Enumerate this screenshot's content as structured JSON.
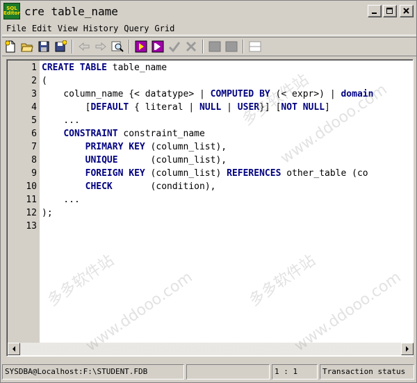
{
  "window": {
    "title": "cre table_name",
    "icon_lines": [
      "SQL",
      "Editor"
    ]
  },
  "menu": [
    "File",
    "Edit",
    "View",
    "History",
    "Query",
    "Grid"
  ],
  "toolbar": {
    "buttons": [
      "new-icon",
      "open-icon",
      "save-icon",
      "save-as-icon",
      "back-icon",
      "forward-icon",
      "find-icon",
      "execute-icon",
      "execute-step-icon",
      "commit-icon",
      "rollback-icon",
      "grid-icon",
      "grid2-icon",
      "split-icon"
    ]
  },
  "editor": {
    "line_numbers": [
      "1",
      "2",
      "3",
      "4",
      "5",
      "6",
      "7",
      "8",
      "9",
      "10",
      "11",
      "12",
      "13"
    ],
    "lines": [
      [
        {
          "t": "CREATE TABLE",
          "k": 1
        },
        {
          "t": " table_name",
          "k": 0
        }
      ],
      [
        {
          "t": "(",
          "k": 0
        }
      ],
      [
        {
          "t": "    column_name {< datatype> | ",
          "k": 0
        },
        {
          "t": "COMPUTED BY",
          "k": 1
        },
        {
          "t": " (< expr>) | ",
          "k": 0
        },
        {
          "t": "domain",
          "k": 1
        }
      ],
      [
        {
          "t": "        [",
          "k": 0
        },
        {
          "t": "DEFAULT",
          "k": 1
        },
        {
          "t": " { literal | ",
          "k": 0
        },
        {
          "t": "NULL",
          "k": 1
        },
        {
          "t": " | ",
          "k": 0
        },
        {
          "t": "USER",
          "k": 1
        },
        {
          "t": "}] [",
          "k": 0
        },
        {
          "t": "NOT NULL",
          "k": 1
        },
        {
          "t": "]",
          "k": 0
        }
      ],
      [
        {
          "t": "    ...",
          "k": 0
        }
      ],
      [
        {
          "t": "    ",
          "k": 0
        },
        {
          "t": "CONSTRAINT",
          "k": 1
        },
        {
          "t": " constraint_name",
          "k": 0
        }
      ],
      [
        {
          "t": "        ",
          "k": 0
        },
        {
          "t": "PRIMARY KEY",
          "k": 1
        },
        {
          "t": " (column_list),",
          "k": 0
        }
      ],
      [
        {
          "t": "        ",
          "k": 0
        },
        {
          "t": "UNIQUE",
          "k": 1
        },
        {
          "t": "      (column_list),",
          "k": 0
        }
      ],
      [
        {
          "t": "        ",
          "k": 0
        },
        {
          "t": "FOREIGN KEY",
          "k": 1
        },
        {
          "t": " (column_list) ",
          "k": 0
        },
        {
          "t": "REFERENCES",
          "k": 1
        },
        {
          "t": " other_table (co",
          "k": 0
        }
      ],
      [
        {
          "t": "        ",
          "k": 0
        },
        {
          "t": "CHECK",
          "k": 1
        },
        {
          "t": "       (condition),",
          "k": 0
        }
      ],
      [
        {
          "t": "    ...",
          "k": 0
        }
      ],
      [
        {
          "t": ");",
          "k": 0
        }
      ],
      [
        {
          "t": "",
          "k": 0
        }
      ]
    ]
  },
  "status": {
    "connection": "SYSDBA@Localhost:F:\\STUDENT.FDB",
    "panel2": "",
    "position": "1 : 1",
    "transaction": "Transaction status"
  },
  "watermark": {
    "cn": "多多软件站",
    "url": "www.ddooo.com"
  },
  "colors": {
    "keyword": "#000080",
    "gutter": "#d4d0c8",
    "face": "#d4d0c8"
  }
}
